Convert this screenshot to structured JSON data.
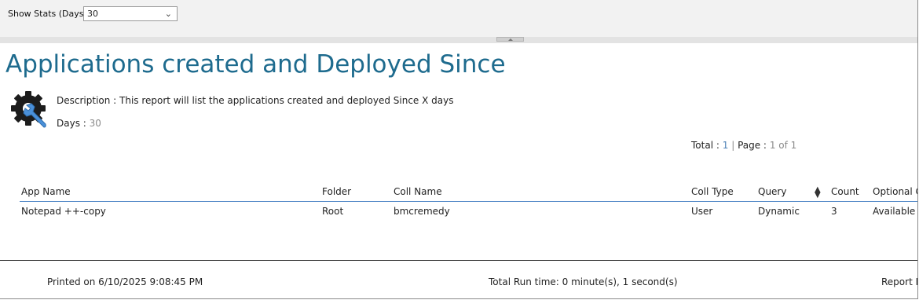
{
  "params": {
    "show_stats_label": "Show Stats (Days)",
    "show_stats_value": "30"
  },
  "report": {
    "title": "Applications created and Deployed Since",
    "description": "Description : This report will list the applications created and deployed Since X days",
    "days_label": "Days :",
    "days_value": "30",
    "icon": "gear-wrench-icon"
  },
  "pagination": {
    "total_label": "Total :",
    "total_value": "1",
    "separator": "|",
    "page_label": "Page :",
    "page_value": "1 of 1"
  },
  "table": {
    "columns": [
      "App Name",
      "Folder",
      "Coll Name",
      "Coll Type",
      "Query",
      "Count",
      "Optional C"
    ],
    "rows": [
      [
        "Notepad ++-copy",
        "Root",
        "bmcremedy",
        "User",
        "Dynamic",
        "3",
        "Available"
      ]
    ]
  },
  "footer": {
    "printed_on": "Printed on 6/10/2025 9:08:45 PM",
    "run_time": "Total Run time: 0 minute(s), 1 second(s)",
    "report_cut": "Report F"
  },
  "colors": {
    "title": "#1e6b8e",
    "header_rule": "#4f86c6",
    "muted_value": "#8a8a8a"
  }
}
